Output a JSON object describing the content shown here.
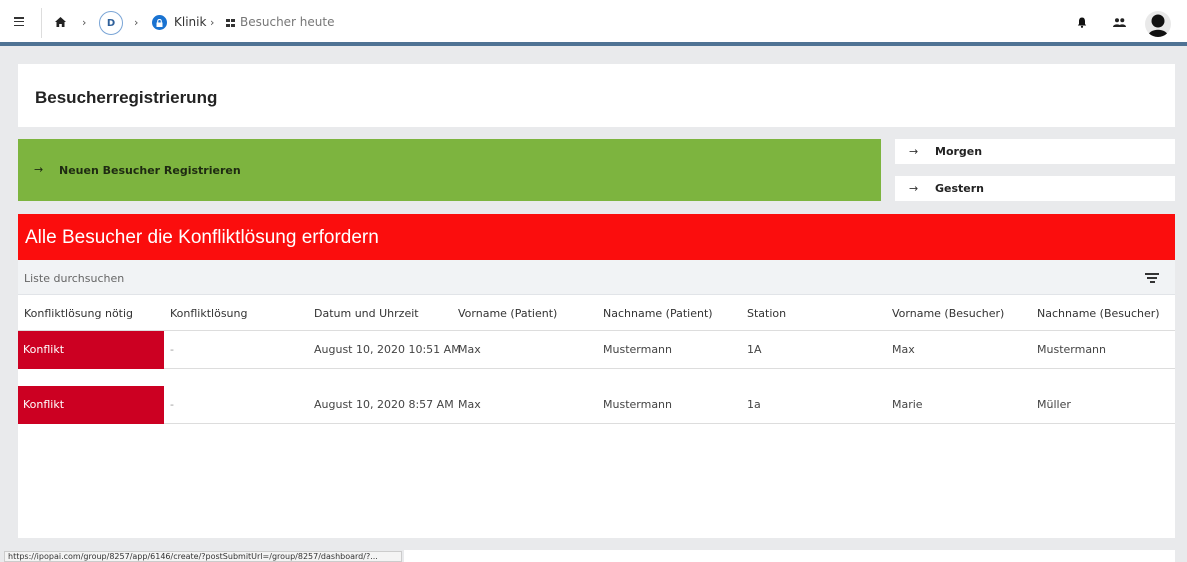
{
  "breadcrumb": {
    "workspace_initial": "D",
    "app": "Klinik",
    "page": "Besucher heute"
  },
  "page_title": "Besucherregistrierung",
  "actions": {
    "register": "Neuen Besucher Registrieren",
    "tomorrow": "Morgen",
    "yesterday": "Gestern",
    "arrow": "→"
  },
  "conflicts": {
    "title": "Alle Besucher die Konfliktlösung erfordern",
    "search_placeholder": "Liste durchsuchen",
    "columns": [
      "Konfliktlösung nötig",
      "Konfliktlösung",
      "Datum und Uhrzeit",
      "Vorname (Patient)",
      "Nachname (Patient)",
      "Station",
      "Vorname (Besucher)",
      "Nachname (Besucher)"
    ],
    "rows": [
      [
        "Konflikt",
        "-",
        "August 10, 2020 10:51 AM",
        "Max",
        "Mustermann",
        "1A",
        "Max",
        "Mustermann"
      ],
      [
        "Konflikt",
        "-",
        "August 10, 2020 8:57 AM",
        "Max",
        "Mustermann",
        "1a",
        "Marie",
        "Müller"
      ]
    ],
    "badge_color": "#cc0022",
    "header_color": "#fb0d0d"
  },
  "register_color": "#7db43f",
  "status_url": "https://ipopai.com/group/8257/app/6146/create/?postSubmitUrl=/group/8257/dashboard/?..."
}
